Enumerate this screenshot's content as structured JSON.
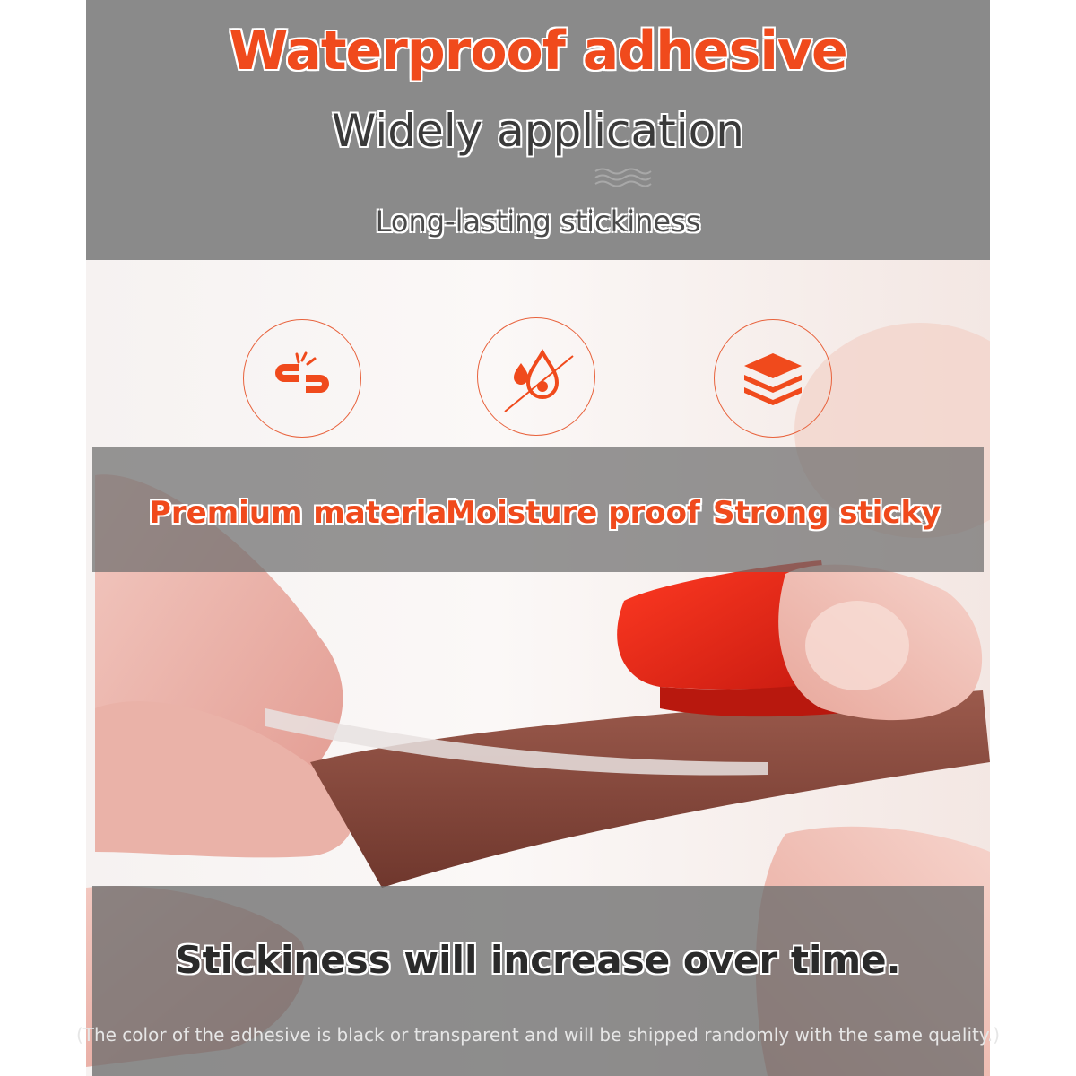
{
  "header": {
    "title": "Waterproof adhesive",
    "subtitle": "Widely application",
    "tagline": "Long-lasting stickiness"
  },
  "features": [
    {
      "label": "Premium material",
      "icon": "broken-chain-icon"
    },
    {
      "label": "Moisture proof",
      "icon": "no-water-drop-icon"
    },
    {
      "label": "Strong sticky",
      "icon": "layers-icon"
    }
  ],
  "footer": {
    "headline": "Stickiness will increase over time.",
    "note": "(The color of the adhesive is black or transparent and will be shipped randomly with the same quality.)"
  },
  "colors": {
    "accent": "#f04a1c",
    "band_gray": "#8a8a8a",
    "tape_red": "#e8251a",
    "tape_brown": "#8a4a3e"
  }
}
